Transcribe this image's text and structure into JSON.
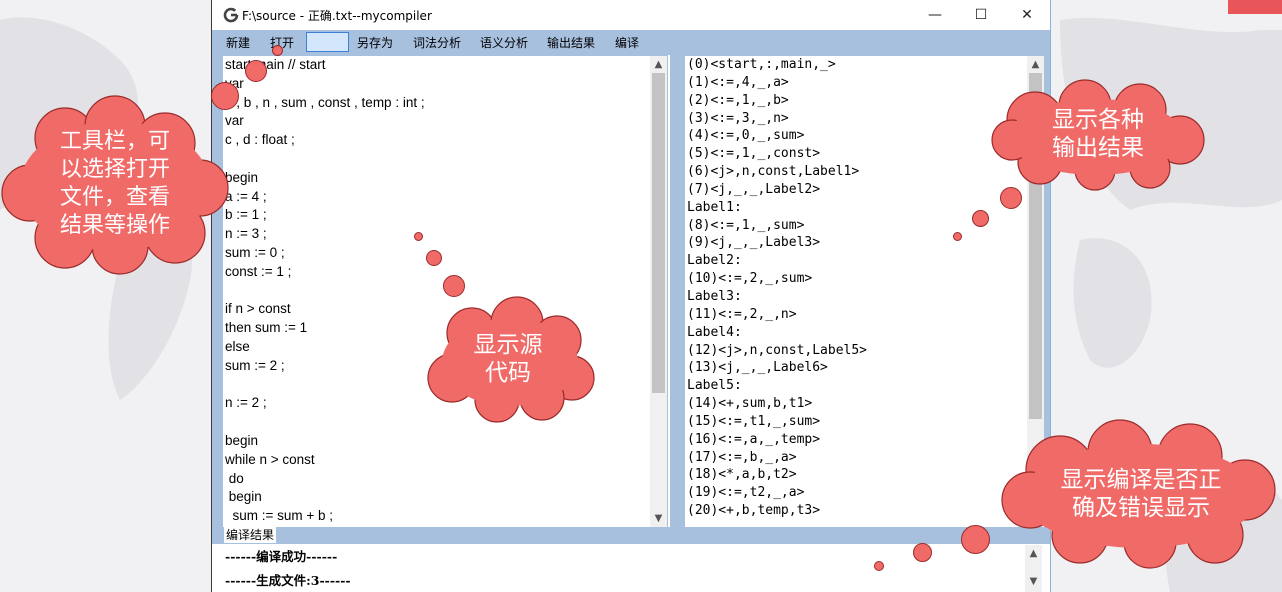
{
  "window": {
    "title": "F:\\source - 正确.txt--mycompiler",
    "controls": {
      "minimize": "—",
      "maximize": "☐",
      "close": "✕"
    }
  },
  "menu": {
    "items": [
      {
        "label": "新建"
      },
      {
        "label": "打开"
      },
      {
        "label": "另存为"
      },
      {
        "label": "词法分析"
      },
      {
        "label": "语义分析"
      },
      {
        "label": "输出结果"
      },
      {
        "label": "编译"
      }
    ],
    "field_value": ""
  },
  "editor": {
    "lines": [
      "start main // start",
      "var",
      "a , b , n , sum , const , temp : int ;",
      "var",
      "c , d : float ;",
      "",
      "begin",
      "a := 4 ;",
      "b := 1 ;",
      "n := 3 ;",
      "sum := 0 ;",
      "const := 1 ;",
      "",
      "if n > const",
      "then sum := 1",
      "else",
      "sum := 2 ;",
      "",
      "n := 2 ;",
      "",
      "begin",
      "while n > const",
      " do",
      " begin",
      "  sum := sum + b ;"
    ]
  },
  "output": {
    "lines": [
      "(0)<start,:,main,_>",
      "(1)<:=,4,_,a>",
      "(2)<:=,1,_,b>",
      "(3)<:=,3,_,n>",
      "(4)<:=,0,_,sum>",
      "(5)<:=,1,_,const>",
      "(6)<j>,n,const,Label1>",
      "(7)<j,_,_,Label2>",
      "Label1:",
      "(8)<:=,1,_,sum>",
      "(9)<j,_,_,Label3>",
      "Label2:",
      "(10)<:=,2,_,sum>",
      "Label3:",
      "(11)<:=,2,_,n>",
      "Label4:",
      "(12)<j>,n,const,Label5>",
      "(13)<j,_,_,Label6>",
      "Label5:",
      "(14)<+,sum,b,t1>",
      "(15)<:=,t1,_,sum>",
      "(16)<:=,a,_,temp>",
      "(17)<:=,b,_,a>",
      "(18)<*,a,b,t2>",
      "(19)<:=,t2,_,a>",
      "(20)<+,b,temp,t3>"
    ]
  },
  "status": {
    "label": "编译结果",
    "lines": [
      "------编译成功------",
      "------生成文件:3------"
    ]
  },
  "annotations": [
    {
      "text": "工具栏，可\n以选择打开\n文件，查看\n结果等操作"
    },
    {
      "text": "显示源\n代码"
    },
    {
      "text": "显示各种\n输出结果"
    },
    {
      "text": "显示编译是否正\n确及错误显示"
    }
  ],
  "colors": {
    "menu_bg": "#a7c0de",
    "cloud_fill": "#f06a68",
    "cloud_stroke": "#9a2b2b"
  }
}
